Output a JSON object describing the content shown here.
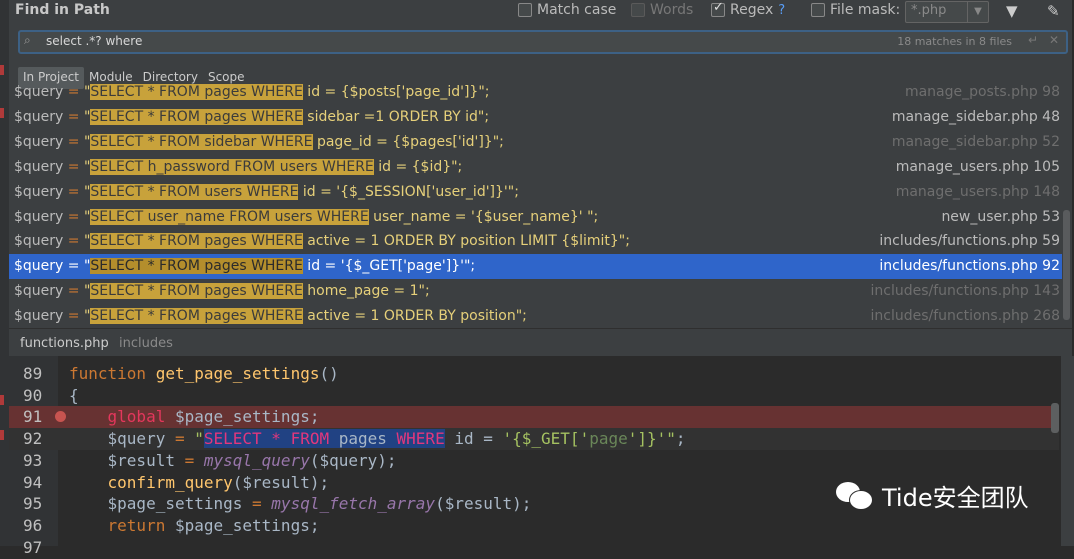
{
  "dialog": {
    "title": "Find in Path",
    "options": {
      "match_case": {
        "label": "Match case",
        "checked": false
      },
      "words": {
        "label": "Words",
        "checked": false
      },
      "regex": {
        "label": "Regex",
        "checked": true,
        "help": "?"
      },
      "file_mask": {
        "label": "File mask:",
        "checked": false,
        "value": "*.php"
      }
    },
    "icons": {
      "filter": "filter-icon",
      "pin": "pin-icon"
    }
  },
  "search": {
    "query": "select .*? where",
    "matches": "18 matches in 8 files"
  },
  "scopes": [
    {
      "label": "In Project",
      "active": true
    },
    {
      "label": "Module",
      "active": false
    },
    {
      "label": "Directory",
      "active": false
    },
    {
      "label": "Scope",
      "active": false
    }
  ],
  "results": [
    {
      "var": "$query",
      "op": " = ",
      "q1": "\"",
      "match": "SELECT * FROM pages WHERE",
      "rest": " id = {$posts['page_id']}\";",
      "file": "manage_posts.php 98",
      "dim": true,
      "selected": false
    },
    {
      "var": "$query",
      "op": " = ",
      "q1": "\"",
      "match": "SELECT * FROM pages WHERE",
      "rest": " sidebar =1 ORDER BY id\";",
      "file": "manage_sidebar.php 48",
      "dim": false,
      "selected": false
    },
    {
      "var": "$query",
      "op": " = ",
      "q1": "\"",
      "match": "SELECT * FROM sidebar WHERE",
      "rest": " page_id = {$pages['id']}\";",
      "file": "manage_sidebar.php 52",
      "dim": true,
      "selected": false
    },
    {
      "var": "$query",
      "op": " = ",
      "q1": "\"",
      "match": "SELECT h_password FROM users WHERE",
      "rest": " id = {$id}\";",
      "file": "manage_users.php 105",
      "dim": false,
      "selected": false
    },
    {
      "var": "$query",
      "op": " = ",
      "q1": "\"",
      "match": "SELECT * FROM users WHERE",
      "rest": " id = '{$_SESSION['user_id']}'\";",
      "file": "manage_users.php 148",
      "dim": true,
      "selected": false
    },
    {
      "var": "$query",
      "op": " = ",
      "q1": "\"",
      "match": "SELECT user_name FROM users WHERE",
      "rest": " user_name = '{$user_name}' \";",
      "file": "new_user.php 53",
      "dim": false,
      "selected": false
    },
    {
      "var": "$query",
      "op": " = ",
      "q1": "\"",
      "match": "SELECT * FROM pages WHERE",
      "rest": " active = 1 ORDER BY position LIMIT {$limit}\";",
      "file": "includes/functions.php 59",
      "dim": false,
      "selected": false
    },
    {
      "var": "$query",
      "op": " = ",
      "q1": "\"",
      "match": "SELECT * FROM pages WHERE",
      "rest": " id = '{$_GET['page']}'\";",
      "file": "includes/functions.php 92",
      "dim": false,
      "selected": true
    },
    {
      "var": "$query",
      "op": " = ",
      "q1": "\"",
      "match": "SELECT * FROM pages WHERE",
      "rest": " home_page = 1\";",
      "file": "includes/functions.php 143",
      "dim": true,
      "selected": false
    },
    {
      "var": "$query",
      "op": " = ",
      "q1": "\"",
      "match": "SELECT * FROM pages WHERE",
      "rest": " active = 1 ORDER BY position\";",
      "file": "includes/functions.php 268",
      "dim": true,
      "selected": false
    }
  ],
  "preview": {
    "file": "functions.php",
    "dir": "includes"
  },
  "editor": {
    "lines": [
      {
        "num": "89",
        "parts": [
          [
            "k",
            "function "
          ],
          [
            "fn",
            "get_page_settings"
          ],
          [
            "pv",
            "()"
          ]
        ]
      },
      {
        "num": "90",
        "parts": [
          [
            "pv",
            "{"
          ]
        ]
      },
      {
        "num": "91",
        "bp": true,
        "parts": [
          [
            "pv",
            "    "
          ],
          [
            "kw-red",
            "global "
          ],
          [
            "pv",
            "$page_settings;"
          ]
        ]
      },
      {
        "num": "92",
        "cur": true,
        "parts": [
          [
            "pv",
            "    $query "
          ],
          [
            "k",
            "= "
          ],
          [
            "q",
            "\""
          ],
          [
            "selq-sq-k",
            "SELECT * FROM "
          ],
          [
            "selq-pv",
            "pages "
          ],
          [
            "selq-sq-k",
            "WHERE"
          ],
          [
            "pv",
            " id = "
          ],
          [
            "q",
            "'{$_GET['"
          ],
          [
            "s",
            "page"
          ],
          [
            "q",
            "']}'\""
          ],
          [
            "pv",
            ";"
          ]
        ]
      },
      {
        "num": "93",
        "parts": [
          [
            "pv",
            "    $result "
          ],
          [
            "k",
            "= "
          ],
          [
            "it",
            "mysql_query"
          ],
          [
            "pv",
            "($query);"
          ]
        ]
      },
      {
        "num": "94",
        "parts": [
          [
            "pv",
            "    "
          ],
          [
            "fn",
            "confirm_query"
          ],
          [
            "pv",
            "($result);"
          ]
        ]
      },
      {
        "num": "95",
        "parts": [
          [
            "pv",
            "    $page_settings "
          ],
          [
            "k",
            "= "
          ],
          [
            "it",
            "mysql_fetch_array"
          ],
          [
            "pv",
            "($result);"
          ]
        ]
      },
      {
        "num": "96",
        "parts": [
          [
            "pv",
            "    "
          ],
          [
            "k",
            "return "
          ],
          [
            "pv",
            "$page_settings;"
          ]
        ]
      },
      {
        "num": "97",
        "parts": [
          [
            "pv",
            ""
          ]
        ]
      }
    ]
  },
  "watermark": {
    "text": "Tide安全团队",
    "icon": "wechat-icon"
  }
}
